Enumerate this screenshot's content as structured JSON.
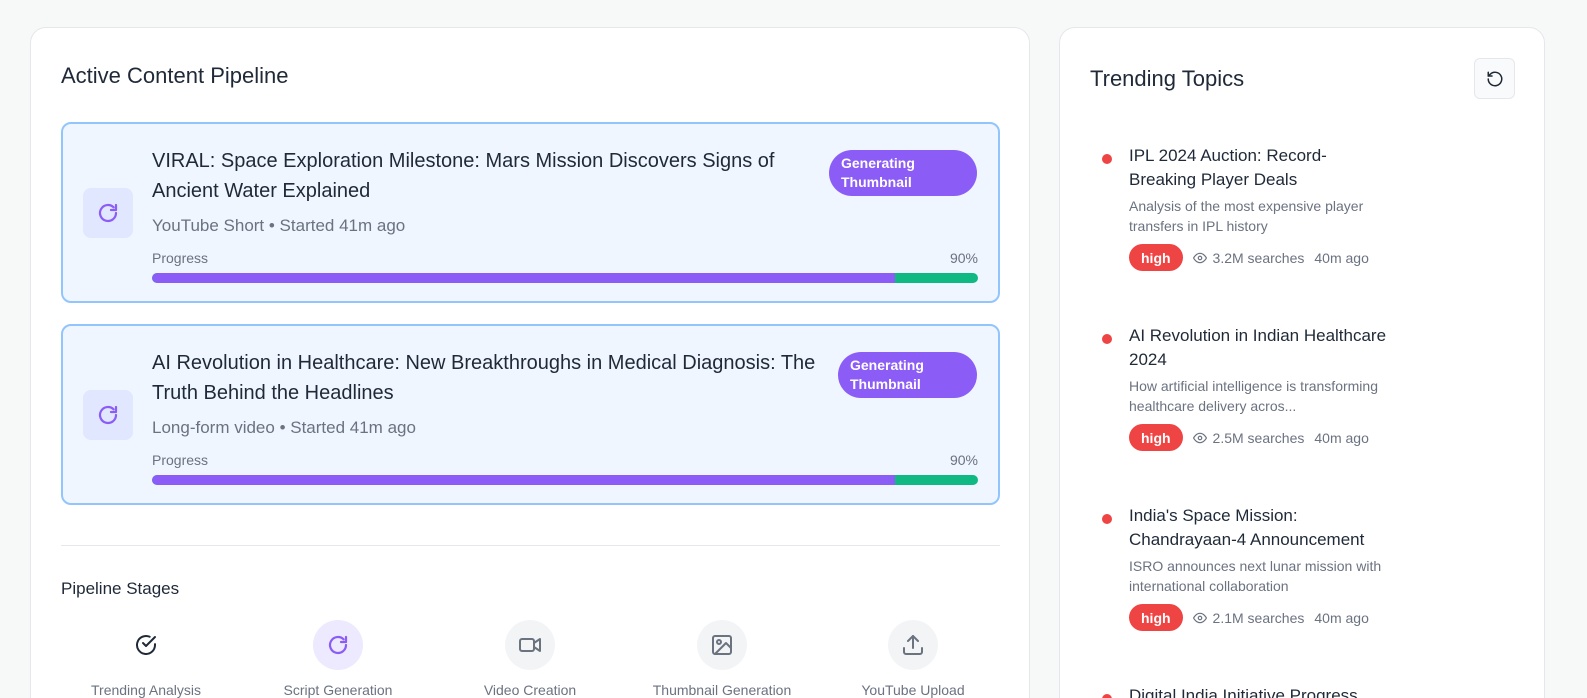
{
  "pipeline": {
    "title": "Active Content Pipeline",
    "jobs": [
      {
        "title": "VIRAL: Space Exploration Milestone: Mars Mission Discovers Signs of Ancient Water Explained",
        "status": "Generating Thumbnail",
        "meta": "YouTube Short • Started 41m ago",
        "progress_label": "Progress",
        "progress_text": "90%",
        "progress": 90
      },
      {
        "title": "AI Revolution in Healthcare: New Breakthroughs in Medical Diagnosis: The Truth Behind the Headlines",
        "status": "Generating Thumbnail",
        "meta": "Long-form video • Started 41m ago",
        "progress_label": "Progress",
        "progress_text": "90%",
        "progress": 90
      }
    ],
    "stages_title": "Pipeline Stages",
    "stages": [
      {
        "label": "Trending Analysis",
        "icon": "check-circle-icon",
        "state": "done"
      },
      {
        "label": "Script Generation",
        "icon": "refresh-icon",
        "state": "active"
      },
      {
        "label": "Video Creation",
        "icon": "video-icon",
        "state": "pending"
      },
      {
        "label": "Thumbnail Generation",
        "icon": "image-icon",
        "state": "pending"
      },
      {
        "label": "YouTube Upload",
        "icon": "upload-icon",
        "state": "pending"
      }
    ]
  },
  "trending": {
    "title": "Trending Topics",
    "topics": [
      {
        "title": "IPL 2024 Auction: Record-Breaking Player Deals",
        "description": "Analysis of the most expensive player transfers in IPL history",
        "priority": "high",
        "searches": "3.2M searches",
        "time": "40m ago"
      },
      {
        "title": "AI Revolution in Indian Healthcare 2024",
        "description": "How artificial intelligence is transforming healthcare delivery acros...",
        "priority": "high",
        "searches": "2.5M searches",
        "time": "40m ago"
      },
      {
        "title": "India's Space Mission: Chandrayaan-4 Announcement",
        "description": "ISRO announces next lunar mission with international collaboration",
        "priority": "high",
        "searches": "2.1M searches",
        "time": "40m ago"
      },
      {
        "title": "Digital India Initiative Progress",
        "description": "",
        "priority": "",
        "searches": "",
        "time": ""
      }
    ]
  },
  "colors": {
    "accent": "#8b5cf6",
    "success": "#10b981",
    "danger": "#ef4444",
    "job_border": "#93c5fd",
    "job_bg": "#eff6ff"
  }
}
